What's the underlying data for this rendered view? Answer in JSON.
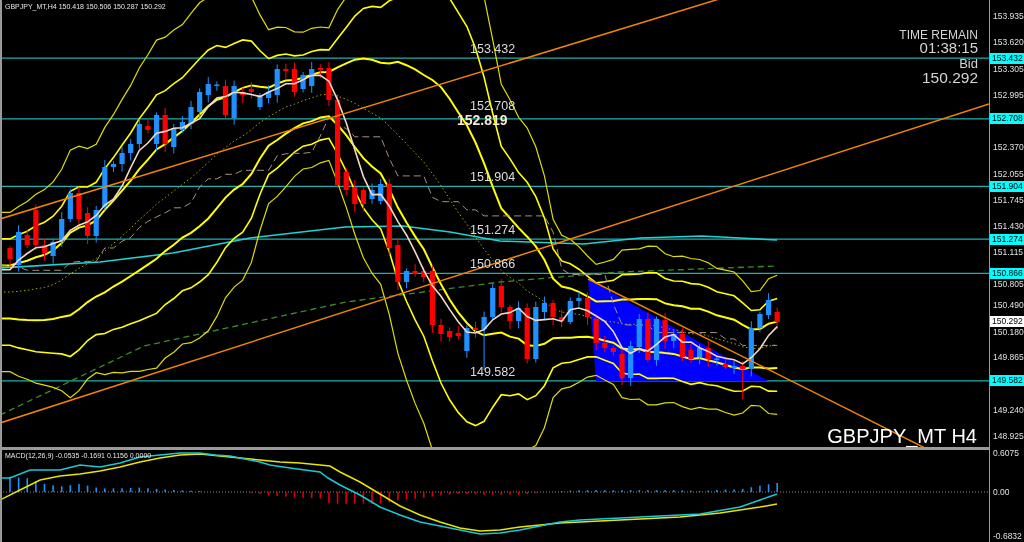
{
  "chart": {
    "info": "GBPJPY_MT,H4 150.418 150.506 150.287 150.292",
    "countdown": {
      "title": "TIME REMAIN",
      "time": "01:38:15",
      "price_label": "Bid",
      "price": "150.292"
    },
    "levels": [
      {
        "label": "153.432",
        "tag": "153.432"
      },
      {
        "label": "152.708",
        "tag": "152.708"
      },
      {
        "label": "151.904",
        "tag": "151.904"
      },
      {
        "label": "151.274",
        "tag": "151.274"
      },
      {
        "label": "150.866",
        "tag": "150.866"
      },
      {
        "label": "149.582",
        "tag": "149.582"
      }
    ],
    "marked_price": "152.819",
    "symbol_label": "GBPJPY_MT H4",
    "price_axis": {
      "labels": [
        "153.935",
        "153.620",
        "153.305",
        "152.995",
        "152.370",
        "152.055",
        "151.745",
        "151.430",
        "151.115",
        "150.805",
        "150.490",
        "150.180",
        "149.865",
        "149.240",
        "148.925"
      ],
      "bid_tag": "150.292"
    }
  },
  "macd": {
    "info": "MACD(12,26,9) -0.0535 -0.1691 0.1156 0.0000",
    "axis_labels": [
      "0.6075",
      "0.00",
      "-0.6832"
    ]
  }
}
